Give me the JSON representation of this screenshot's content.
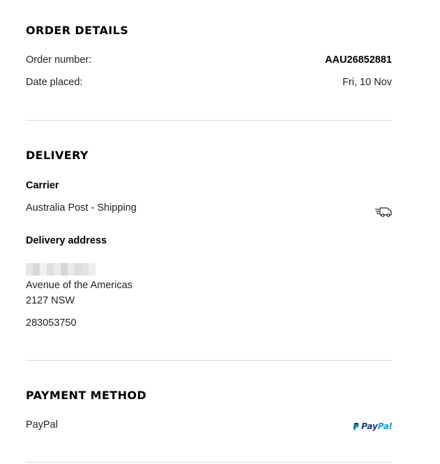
{
  "order_details": {
    "title": "ORDER DETAILS",
    "order_number_label": "Order number:",
    "order_number_value": "AAU26852881",
    "date_placed_label": "Date placed:",
    "date_placed_value": "Fri, 10 Nov"
  },
  "delivery": {
    "title": "DELIVERY",
    "carrier_heading": "Carrier",
    "carrier_value": "Australia Post - Shipping",
    "carrier_icon": "delivery-truck-icon",
    "address_heading": "Delivery address",
    "address_line1": "Avenue of the Americas",
    "address_line2": "2127 NSW",
    "phone": "283053750"
  },
  "payment": {
    "title": "PAYMENT METHOD",
    "method": "PayPal",
    "logo_pay": "Pay",
    "logo_pal": "Pal",
    "logo_icon": "paypal-logo-icon"
  },
  "colors": {
    "text": "#222222",
    "divider": "#dcdcdc",
    "paypal_dark": "#253b80",
    "paypal_light": "#179bd7"
  }
}
